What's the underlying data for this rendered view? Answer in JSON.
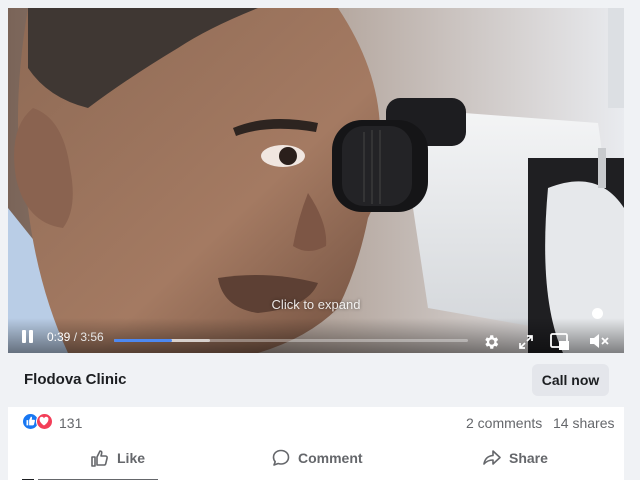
{
  "video": {
    "overlay_hint": "Click to expand",
    "current_time": "0:39",
    "duration": "3:56",
    "progress_fraction": 0.165,
    "buffered_fraction": 0.27,
    "controls": [
      "pause-icon",
      "gear-icon",
      "expand-icon",
      "pip-icon",
      "mute-icon"
    ]
  },
  "page": {
    "name": "Flodova Clinic",
    "cta_label": "Call now"
  },
  "engagement": {
    "reaction_icons": [
      "like-reaction-icon",
      "love-reaction-icon"
    ],
    "reaction_count": "131",
    "comments": "2 comments",
    "shares": "14 shares"
  },
  "actions": {
    "like_label": "Like",
    "comment_label": "Comment",
    "share_label": "Share"
  },
  "colors": {
    "accent": "#1877f2",
    "progress": "#4d88f0",
    "love": "#f33e58",
    "muted_text": "#65676b"
  }
}
